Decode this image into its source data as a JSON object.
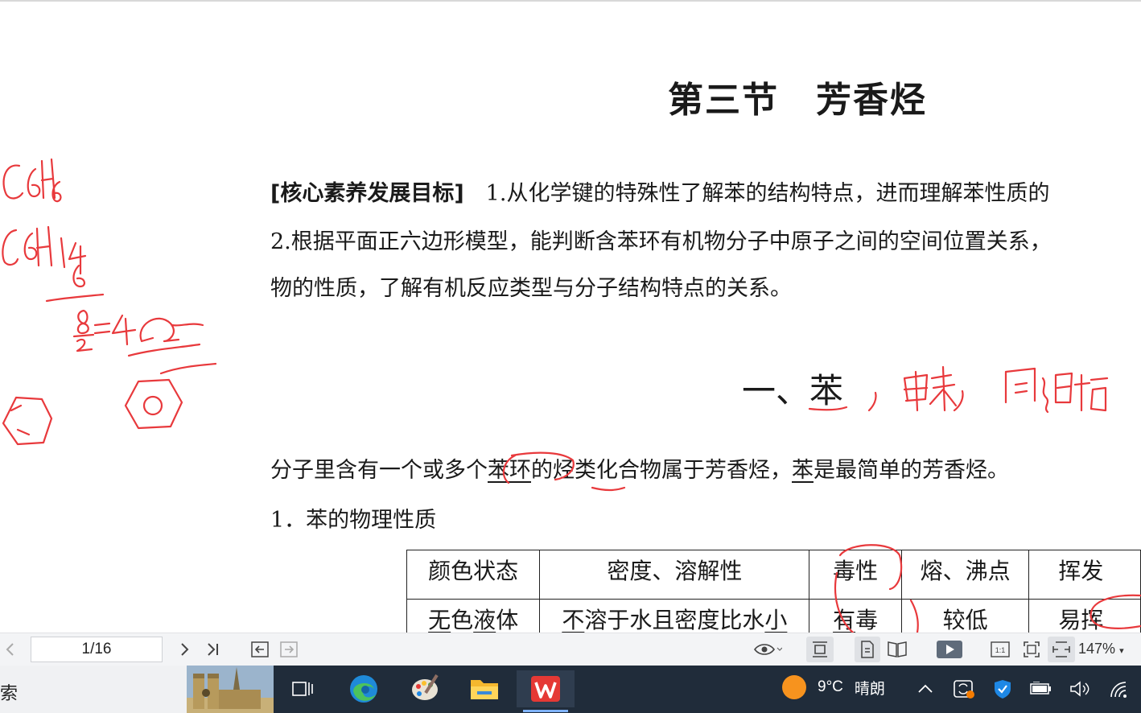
{
  "document": {
    "title": "第三节　芳香烃",
    "goals_label": "[核心素养发展目标]",
    "goals_line1": "　1.从化学键的特殊性了解苯的结构特点，进而理解苯性质的",
    "goals_line2": "2.根据平面正六边形模型，能判断含苯环有机物分子中原子之间的空间位置关系，",
    "goals_line3": "物的性质，了解有机反应类型与分子结构特点的关系。",
    "section_prefix": "一、",
    "section_name": "苯",
    "intro_a": "分子里含有一个或多个",
    "intro_b": "苯环",
    "intro_c": "的烃类化合物属于芳香烃，",
    "intro_d": "苯",
    "intro_e": "是最简单的芳香烃。",
    "subsection": "1．苯的物理性质",
    "table": {
      "headers": [
        "颜色状态",
        "密度、溶解性",
        "毒性",
        "熔、沸点",
        "挥发"
      ],
      "row_a": {
        "p1": "无",
        "p2": "色",
        "p3": "液",
        "p4": "体"
      },
      "row_b": {
        "p1": "不",
        "p2": "溶于水且密度比水",
        "p3": "小"
      },
      "row_c": {
        "p1": "有",
        "p2": "毒"
      },
      "row_d": "较低",
      "row_e": "易挥"
    }
  },
  "annotations": {
    "handwriting": [
      "C6H6",
      "C6H14",
      "6",
      "8",
      "2",
      "=4Ω",
      "，甲苯，同系物"
    ]
  },
  "toolbar": {
    "page_indicator": "1/16",
    "zoom": "147%"
  },
  "taskbar": {
    "search_text": "索",
    "weather_temp": "9°C",
    "weather_desc": "晴朗"
  },
  "colors": {
    "ink": "#e8393c",
    "taskbar_bg": "#202c3a",
    "toolbar_bg": "#f3f4f6"
  }
}
